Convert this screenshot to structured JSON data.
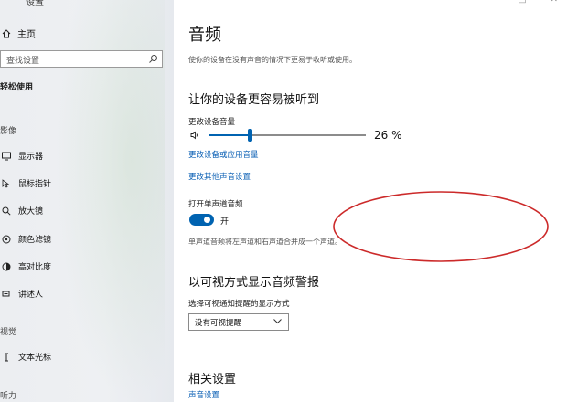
{
  "sidebar": {
    "title": "设置",
    "home": "主页",
    "search_placeholder": "查找设置",
    "category": "轻松使用",
    "section_vision": "影像",
    "items": [
      {
        "label": "显示器",
        "icon": "monitor-icon"
      },
      {
        "label": "鼠标指针",
        "icon": "pointer-icon"
      },
      {
        "label": "放大镜",
        "icon": "magnifier-icon"
      },
      {
        "label": "颜色滤镜",
        "icon": "color-filter-icon"
      },
      {
        "label": "高对比度",
        "icon": "contrast-icon"
      },
      {
        "label": "讲述人",
        "icon": "narrator-icon"
      }
    ],
    "section_hearing": "视觉",
    "hearing_items": [
      {
        "label": "文本光标",
        "icon": "text-cursor-icon"
      }
    ],
    "section_bottom": "听力"
  },
  "main": {
    "title": "音频",
    "subtitle": "使你的设备在没有声音的情况下更易于收听或使用。",
    "heading_hear": "让你的设备更容易被听到",
    "volume_label": "更改设备音量",
    "volume_value": 26,
    "volume_text": "26 %",
    "link_app_volume": "更改设备或应用音量",
    "link_other_sound": "更改其他声音设置",
    "mono_label": "打开单声道音频",
    "mono_state": "开",
    "mono_on": true,
    "mono_desc": "单声道音频将左声道和右声道合并成一个声道。",
    "heading_visual": "以可视方式显示音频警报",
    "visual_label": "选择可视通知提醒的显示方式",
    "visual_value": "没有可视提醒",
    "related_heading": "相关设置",
    "related_link": "声音设置"
  },
  "colors": {
    "accent": "#0063b1",
    "link": "#0a5fb4",
    "annotation": "#cc2a2a"
  }
}
